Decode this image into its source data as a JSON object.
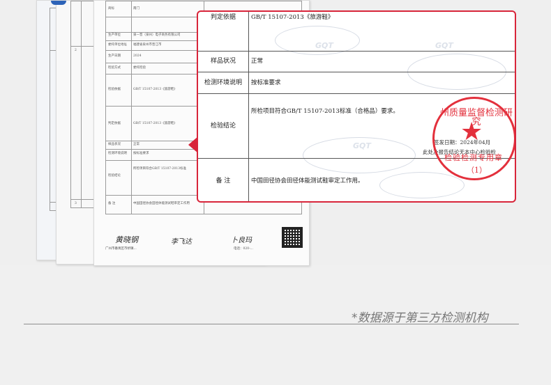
{
  "callout": {
    "rows": [
      {
        "label": "判定依据",
        "value": "GB/T 15107-2013《旅游鞋》"
      },
      {
        "label": "样品状况",
        "value": "正常"
      },
      {
        "label": "检测环境说明",
        "value": "按标准要求"
      },
      {
        "label": "检验结论",
        "value": "所检项目符合GB/T 15107-2013标准（合格品）要求。"
      },
      {
        "label": "备 注",
        "value": "中国田径协会田径体能测试鞋审定工作用。"
      }
    ],
    "watermark": "GQT",
    "issue_date": "签发日期：2024年04月",
    "issue_note": "此处及报告结论无本中心检验检"
  },
  "seal": {
    "text_arc": "州质量监督检测研究",
    "text_mid": "检验检测专用章",
    "number": "（1）"
  },
  "report": {
    "signatures": [
      "黄晓钢",
      "李飞达",
      "卜良玛"
    ],
    "rows": [
      {
        "label": "商标",
        "value": "南门"
      },
      {
        "label": "生产单位",
        "value": "泉一晋（泉州）电子商务有限公司"
      },
      {
        "label": "委托单位地址",
        "value": "福建省泉州市晋江市"
      },
      {
        "label": "生产日期",
        "value": "2024"
      },
      {
        "label": "检验方式",
        "value": "委托检验"
      },
      {
        "label": "检验依据",
        "value": "GB/T 15107-2013《旅游鞋》"
      },
      {
        "label": "判定依据",
        "value": "GB/T 15107-2013《旅游鞋》"
      },
      {
        "label": "样品状况",
        "value": "正常"
      },
      {
        "label": "检测环境说明",
        "value": "按标准要求"
      },
      {
        "label": "检验结论",
        "value": "所检项目符合GB/T 15107-2013标准"
      },
      {
        "label": "备 注",
        "value": "中国田径协会田径体能测试鞋审定工作用"
      }
    ],
    "footer": "广州市番禺区市桥镇...",
    "footer_tel": "电话：020-..."
  },
  "source_note": "*数据源于第三方检测机构"
}
